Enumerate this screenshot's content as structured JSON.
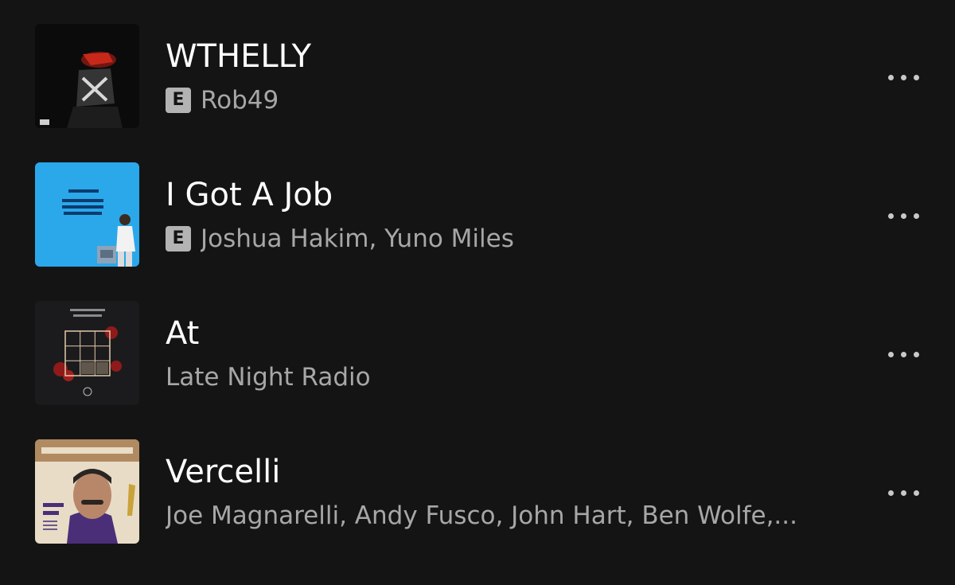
{
  "tracks": [
    {
      "title": "WTHELLY",
      "explicit": true,
      "explicit_label": "E",
      "artists": "Rob49",
      "art_icon": "album-art-dark-red-figure"
    },
    {
      "title": "I Got A Job",
      "explicit": true,
      "explicit_label": "E",
      "artists": "Joshua Hakim, Yuno Miles",
      "art_icon": "album-art-blue-person"
    },
    {
      "title": "At",
      "explicit": false,
      "artists": "Late Night Radio",
      "art_icon": "album-art-love-is-free-grid"
    },
    {
      "title": "Vercelli",
      "explicit": false,
      "artists": "Joe Magnarelli, Andy Fusco, John Hart, Ben Wolfe,...",
      "art_icon": "album-art-magic-trick-portrait"
    }
  ],
  "colors": {
    "background": "#141414",
    "title": "#ffffff",
    "artist": "#a7a7a7",
    "explicit_badge": "#b3b3b3"
  },
  "more_icon": "more-options-icon"
}
